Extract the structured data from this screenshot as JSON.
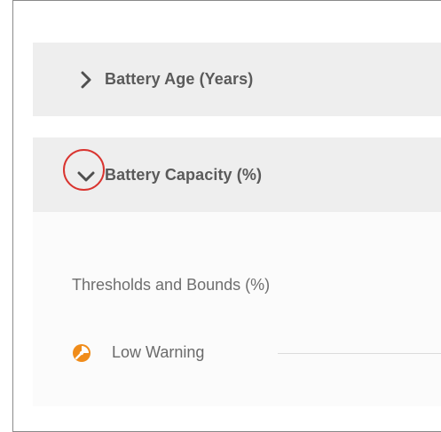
{
  "panels": {
    "battery_age": {
      "label": "Battery Age (Years)",
      "icon": "chevron-right-icon",
      "expanded": false
    },
    "battery_capacity": {
      "label": "Battery Capacity (%)",
      "icon": "chevron-down-icon",
      "expanded": true,
      "highlight_color": "#d9342f",
      "content": {
        "section_title": "Thresholds and Bounds (%)",
        "rows": [
          {
            "label": "Low Warning",
            "icon": "low-warning-icon",
            "icon_color": "#f08c1a"
          }
        ]
      }
    }
  }
}
